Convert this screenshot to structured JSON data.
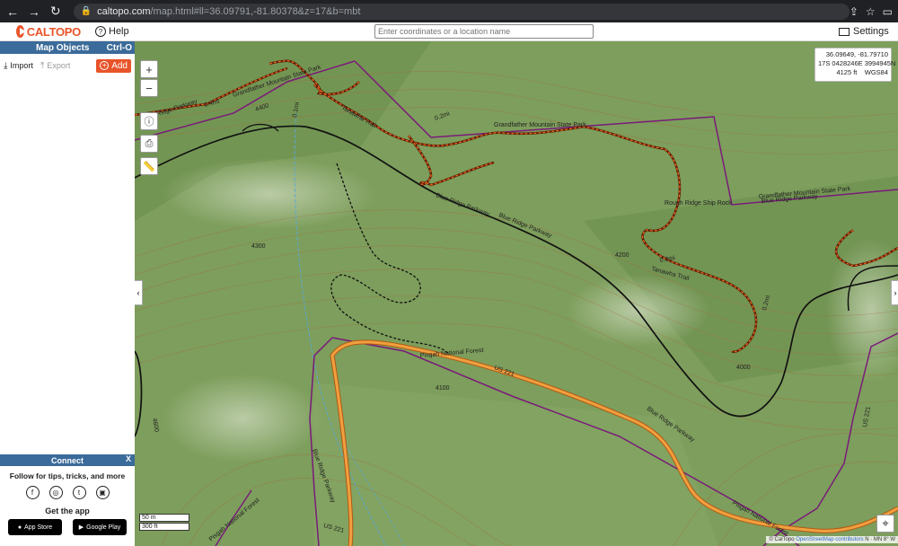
{
  "browser": {
    "url_domain": "caltopo.com",
    "url_path": "/map.html#ll=36.09791,-81.80378&z=17&b=mbt"
  },
  "header": {
    "logo_text": "CALTOPO",
    "help_label": "Help",
    "search_placeholder": "Enter coordinates or a location name",
    "settings_label": "Settings"
  },
  "sidebar": {
    "title": "Map Objects",
    "shortcut": "Ctrl-O",
    "import_label": "Import",
    "export_label": "Export",
    "add_label": "Add"
  },
  "connect": {
    "title": "Connect",
    "close": "X",
    "follow_text": "Follow for tips, tricks, and more",
    "socials": [
      "facebook-icon",
      "instagram-icon",
      "tumblr-icon",
      "caltopo-icon"
    ],
    "get_app": "Get the app",
    "app_store": "App Store",
    "google_play": "Google Play"
  },
  "map": {
    "coords": {
      "latlon": "36.09649, -81.79710",
      "utm": "17S 0428246E 3994945N",
      "elev": "4125 ft",
      "datum": "WGS84"
    },
    "scale_m": "50 m",
    "scale_ft": "300 ft",
    "attribution_prefix": "© CalTopo",
    "attribution_osm": "OpenStreetMap contributors",
    "attribution_suffix": "N · MN 8° W",
    "labels": {
      "gm_sp_1": "Grandfather Mountain State Park",
      "gm_sp_2": "Grandfather Mountain State Park",
      "gm_sp_3": "Grandfather Mountain State Park",
      "brp_1": "Blue Ridge Parkway",
      "brp_2": "Blue Ridge Parkway",
      "brp_3": "Blue Ridge Parkway",
      "brp_4": "Blue Ridge Parkway",
      "brp_5": "Blue Ridge Parkway",
      "brp_6": "Blue Ridge Parkway",
      "tanawha_1": "Tanawha Trail",
      "tanawha_2": "Tanawha Trail",
      "rough_ridge": "Rough Ridge Ship Rock",
      "pisgah_1": "Pisgah National Forest",
      "pisgah_2": "Pisgah National Forest",
      "pisgah_3": "Pisgah National Forest",
      "us221_1": "US 221",
      "us221_2": "US 221",
      "us221_3": "US 221",
      "dist_1": "0.4mi",
      "dist_2": "0.1mi",
      "dist_3": "0.2mi",
      "dist_4": "0.3mi",
      "dist_5": "0.2mi",
      "c_4400": "4400",
      "c_4300": "4300",
      "c_4200": "4200",
      "c_4100": "4100",
      "c_4000": "4000",
      "c_4600": "4600"
    }
  },
  "colors": {
    "boundary": "#7a1a7a",
    "trail": "#d2461a",
    "highway": "#e8861a",
    "parkway": "#111111",
    "accent": "#e8542a",
    "header_blue": "#3b6b9a"
  }
}
